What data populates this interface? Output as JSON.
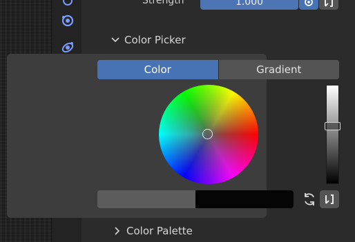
{
  "strength": {
    "label": "Strength",
    "value": "1.000"
  },
  "color_picker": {
    "title": "Color Picker",
    "tabs": [
      {
        "label": "Color",
        "active": true
      },
      {
        "label": "Gradient",
        "active": false
      }
    ],
    "value_level": 0.58,
    "primary_color": "#5c5c5c",
    "secondary_color": "#050505"
  },
  "color_palette": {
    "title": "Color Palette"
  },
  "colors": {
    "accent": "#4772b3",
    "tool_blue": "#7a9cff",
    "tool_teal": "#4fc1b8",
    "tool_red": "#d25b5b"
  },
  "tab_icons": [
    "modifier-icon",
    "physics-icon",
    "vertex-icon",
    "material-icon",
    "texture-icon"
  ]
}
